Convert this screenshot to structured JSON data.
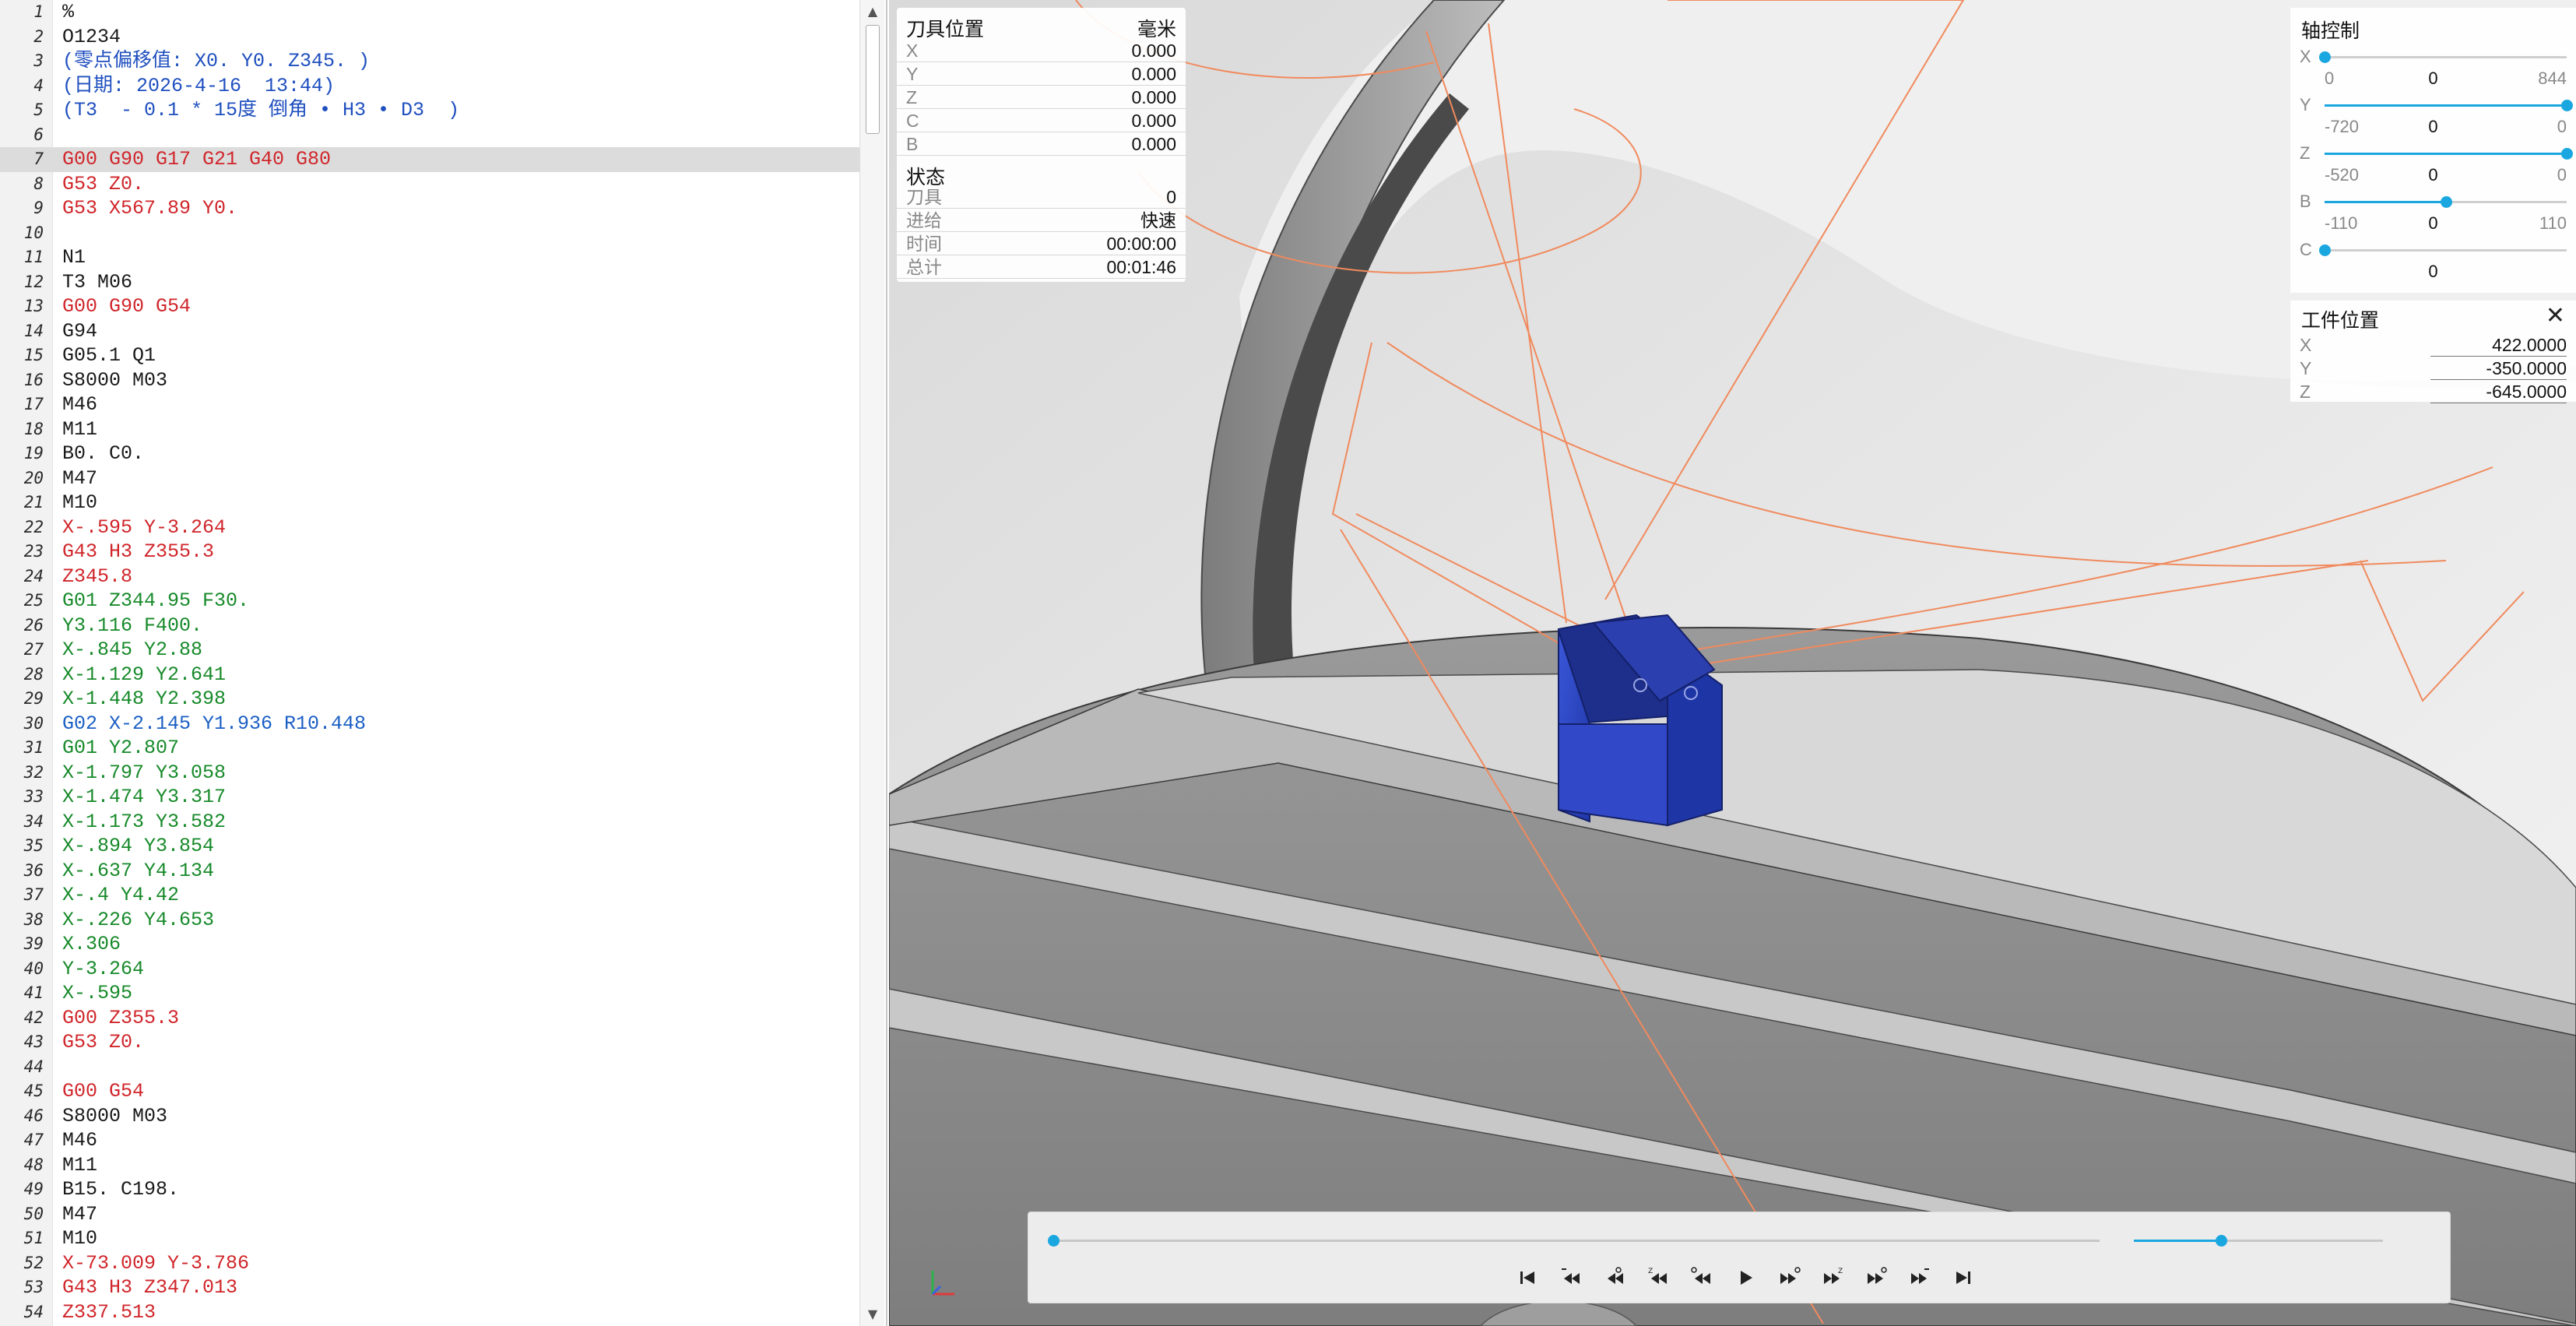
{
  "editor": {
    "lines": [
      {
        "n": "1",
        "t": "%",
        "c": "default"
      },
      {
        "n": "2",
        "t": "O1234",
        "c": "default"
      },
      {
        "n": "3",
        "t": "(零点偏移值: X0. Y0. Z345. )",
        "c": "comment"
      },
      {
        "n": "4",
        "t": "(日期: 2026-4-16  13:44)",
        "c": "comment"
      },
      {
        "n": "5",
        "t": "(T3  - 0.1 * 15度 倒角 • H3 • D3  )",
        "c": "comment"
      },
      {
        "n": "6",
        "t": "",
        "c": "default"
      },
      {
        "n": "7",
        "t": "G00 G90 G17 G21 G40 G80",
        "c": "red",
        "highlight": true
      },
      {
        "n": "8",
        "t": "G53 Z0.",
        "c": "red"
      },
      {
        "n": "9",
        "t": "G53 X567.89 Y0.",
        "c": "red"
      },
      {
        "n": "10",
        "t": "",
        "c": "default"
      },
      {
        "n": "11",
        "t": "N1",
        "c": "default"
      },
      {
        "n": "12",
        "t": "T3 M06",
        "c": "default"
      },
      {
        "n": "13",
        "t": "G00 G90 G54",
        "c": "red"
      },
      {
        "n": "14",
        "t": "G94",
        "c": "default"
      },
      {
        "n": "15",
        "t": "G05.1 Q1",
        "c": "default"
      },
      {
        "n": "16",
        "t": "S8000 M03",
        "c": "default"
      },
      {
        "n": "17",
        "t": "M46",
        "c": "default"
      },
      {
        "n": "18",
        "t": "M11",
        "c": "default"
      },
      {
        "n": "19",
        "t": "B0. C0.",
        "c": "default"
      },
      {
        "n": "20",
        "t": "M47",
        "c": "default"
      },
      {
        "n": "21",
        "t": "M10",
        "c": "default"
      },
      {
        "n": "22",
        "t": "X-.595 Y-3.264",
        "c": "red"
      },
      {
        "n": "23",
        "t": "G43 H3 Z355.3",
        "c": "red"
      },
      {
        "n": "24",
        "t": "Z345.8",
        "c": "red"
      },
      {
        "n": "25",
        "t": "G01 Z344.95 F30.",
        "c": "green"
      },
      {
        "n": "26",
        "t": "Y3.116 F400.",
        "c": "green"
      },
      {
        "n": "27",
        "t": "X-.845 Y2.88",
        "c": "green"
      },
      {
        "n": "28",
        "t": "X-1.129 Y2.641",
        "c": "green"
      },
      {
        "n": "29",
        "t": "X-1.448 Y2.398",
        "c": "green"
      },
      {
        "n": "30",
        "t": "G02 X-2.145 Y1.936 R10.448",
        "c": "blue"
      },
      {
        "n": "31",
        "t": "G01 Y2.807",
        "c": "green"
      },
      {
        "n": "32",
        "t": "X-1.797 Y3.058",
        "c": "green"
      },
      {
        "n": "33",
        "t": "X-1.474 Y3.317",
        "c": "green"
      },
      {
        "n": "34",
        "t": "X-1.173 Y3.582",
        "c": "green"
      },
      {
        "n": "35",
        "t": "X-.894 Y3.854",
        "c": "green"
      },
      {
        "n": "36",
        "t": "X-.637 Y4.134",
        "c": "green"
      },
      {
        "n": "37",
        "t": "X-.4 Y4.42",
        "c": "green"
      },
      {
        "n": "38",
        "t": "X-.226 Y4.653",
        "c": "green"
      },
      {
        "n": "39",
        "t": "X.306",
        "c": "green"
      },
      {
        "n": "40",
        "t": "Y-3.264",
        "c": "green"
      },
      {
        "n": "41",
        "t": "X-.595",
        "c": "green"
      },
      {
        "n": "42",
        "t": "G00 Z355.3",
        "c": "red"
      },
      {
        "n": "43",
        "t": "G53 Z0.",
        "c": "red"
      },
      {
        "n": "44",
        "t": "",
        "c": "default"
      },
      {
        "n": "45",
        "t": "G00 G54",
        "c": "red"
      },
      {
        "n": "46",
        "t": "S8000 M03",
        "c": "default"
      },
      {
        "n": "47",
        "t": "M46",
        "c": "default"
      },
      {
        "n": "48",
        "t": "M11",
        "c": "default"
      },
      {
        "n": "49",
        "t": "B15. C198.",
        "c": "default"
      },
      {
        "n": "50",
        "t": "M47",
        "c": "default"
      },
      {
        "n": "51",
        "t": "M10",
        "c": "default"
      },
      {
        "n": "52",
        "t": "X-73.009 Y-3.786",
        "c": "red"
      },
      {
        "n": "53",
        "t": "G43 H3 Z347.013",
        "c": "red"
      },
      {
        "n": "54",
        "t": "Z337.513",
        "c": "red"
      }
    ]
  },
  "tool_position": {
    "title": "刀具位置",
    "unit": "毫米",
    "rows": [
      {
        "k": "X",
        "v": "0.000"
      },
      {
        "k": "Y",
        "v": "0.000"
      },
      {
        "k": "Z",
        "v": "0.000"
      },
      {
        "k": "C",
        "v": "0.000"
      },
      {
        "k": "B",
        "v": "0.000"
      }
    ],
    "status_title": "状态",
    "status": [
      {
        "k": "刀具",
        "v": "0"
      },
      {
        "k": "进给",
        "v": "快速"
      },
      {
        "k": "时间",
        "v": "00:00:00"
      },
      {
        "k": "总计",
        "v": "00:01:46"
      }
    ]
  },
  "axis_control": {
    "title": "轴控制",
    "axes": [
      {
        "name": "X",
        "min": "0",
        "cur": "0",
        "max": "844",
        "fraction": 0.0
      },
      {
        "name": "Y",
        "min": "-720",
        "cur": "0",
        "max": "0",
        "fraction": 1.0
      },
      {
        "name": "Z",
        "min": "-520",
        "cur": "0",
        "max": "0",
        "fraction": 1.0
      },
      {
        "name": "B",
        "min": "-110",
        "cur": "0",
        "max": "110",
        "fraction": 0.5
      },
      {
        "name": "C",
        "min": "",
        "cur": "0",
        "max": "",
        "fraction": 0.0
      }
    ]
  },
  "work_position": {
    "title": "工件位置",
    "rows": [
      {
        "k": "X",
        "v": "422.0000"
      },
      {
        "k": "Y",
        "v": "-350.0000"
      },
      {
        "k": "Z",
        "v": "-645.0000"
      }
    ]
  },
  "playback": {
    "progress_fraction": 0.0,
    "speed_fraction": 0.35
  },
  "colors": {
    "accent": "#1aa7e0",
    "toolpath": "#f08a5d",
    "workpiece": "#2a46c8"
  }
}
